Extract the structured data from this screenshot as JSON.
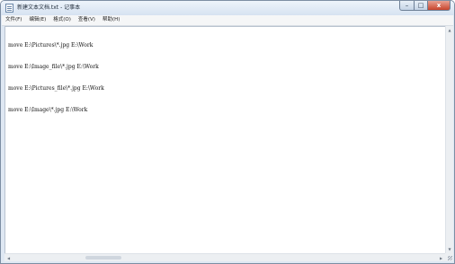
{
  "window": {
    "title": "新建文本文档.txt - 记事本",
    "buttons": {
      "minimize": "–",
      "maximize": "□",
      "close": "x"
    }
  },
  "menubar": {
    "items": [
      {
        "label": "文件(F)"
      },
      {
        "label": "编辑(E)"
      },
      {
        "label": "格式(O)"
      },
      {
        "label": "查看(V)"
      },
      {
        "label": "帮助(H)"
      }
    ]
  },
  "editor": {
    "lines": [
      "move E:\\Pictures\\*.jpg E:\\Work",
      "move E:\\Image_file\\*.jpg E:\\Work",
      "move E:\\Pictures_file\\*.jpg E:\\Work",
      "move E:\\Image\\*.jpg E:\\Work"
    ]
  },
  "scrollbars": {
    "vertical": {
      "up_glyph": "▲",
      "down_glyph": "▼"
    },
    "horizontal": {
      "left_glyph": "◀",
      "right_glyph": "▶"
    }
  },
  "icons": {
    "app": "notepad-icon",
    "resize": "resize-grip-icon"
  },
  "colors": {
    "titlebar": "#d6e2f1",
    "close_button": "#c8442c",
    "editor_background": "#ffffff"
  }
}
